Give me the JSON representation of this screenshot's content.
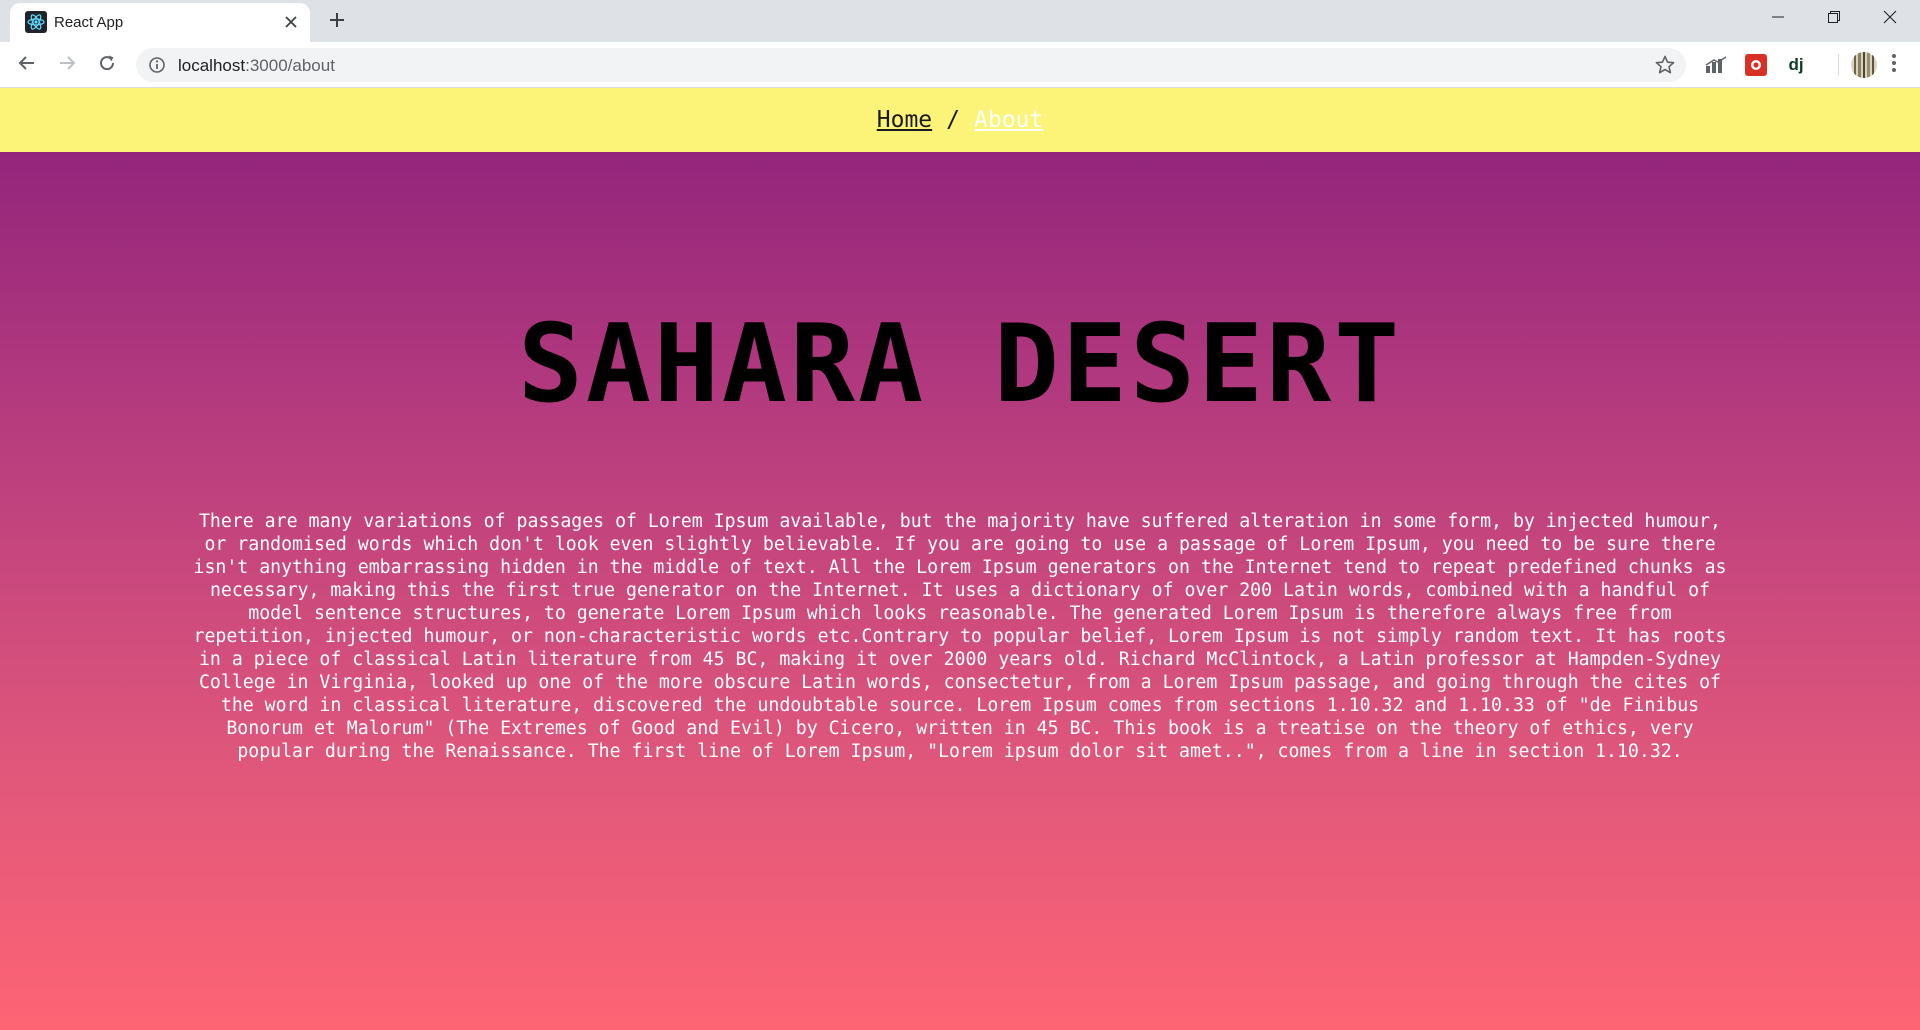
{
  "browser": {
    "tab_title": "React App",
    "url_host": "localhost",
    "url_rest": ":3000/about",
    "icons": {
      "favicon": "react-logo-icon",
      "close": "close-icon",
      "new_tab": "plus-icon",
      "back": "arrow-left-icon",
      "forward": "arrow-right-icon",
      "reload": "reload-icon",
      "info": "info-icon",
      "bookmark": "star-icon"
    },
    "extensions": [
      {
        "name": "chart-extension-icon"
      },
      {
        "name": "red-extension-icon"
      },
      {
        "name": "dj-extension-icon",
        "label": "dj"
      },
      {
        "name": "profile-avatar-icon"
      }
    ]
  },
  "nav": {
    "home_label": "Home",
    "separator": "/",
    "about_label": "About",
    "active": "About"
  },
  "hero": {
    "title": "SAHARA DESERT",
    "body": "There are many variations of passages of Lorem Ipsum available, but the majority have suffered alteration in some form, by injected humour, or randomised words which don't look even slightly believable. If you are going to use a passage of Lorem Ipsum, you need to be sure there isn't anything embarrassing hidden in the middle of text. All the Lorem Ipsum generators on the Internet tend to repeat predefined chunks as necessary, making this the first true generator on the Internet. It uses a dictionary of over 200 Latin words, combined with a handful of model sentence structures, to generate Lorem Ipsum which looks reasonable. The generated Lorem Ipsum is therefore always free from repetition, injected humour, or non-characteristic words etc.Contrary to popular belief, Lorem Ipsum is not simply random text. It has roots in a piece of classical Latin literature from 45 BC, making it over 2000 years old. Richard McClintock, a Latin professor at Hampden-Sydney College in Virginia, looked up one of the more obscure Latin words, consectetur, from a Lorem Ipsum passage, and going through the cites of the word in classical literature, discovered the undoubtable source. Lorem Ipsum comes from sections 1.10.32 and 1.10.33 of \"de Finibus Bonorum et Malorum\" (The Extremes of Good and Evil) by Cicero, written in 45 BC. This book is a treatise on the theory of ethics, very popular during the Renaissance. The first line of Lorem Ipsum, \"Lorem ipsum dolor sit amet..\", comes from a line in section 1.10.32."
  },
  "colors": {
    "nav_bg": "#fcf478",
    "gradient_top": "#93257c",
    "gradient_bottom": "#fe6474",
    "title_color": "#000000",
    "body_color": "#ffffff",
    "about_link": "#ffffff"
  }
}
